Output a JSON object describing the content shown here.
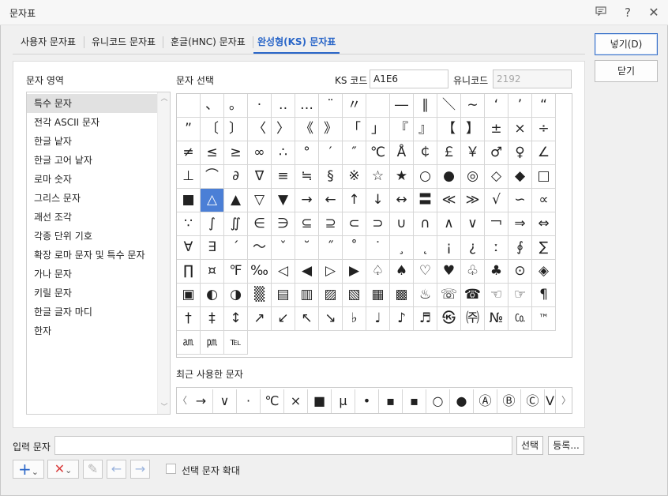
{
  "window": {
    "title": "문자표"
  },
  "tabs": [
    {
      "label": "사용자 문자표"
    },
    {
      "label": "유니코드 문자표"
    },
    {
      "label": "훈글(HNC) 문자표"
    },
    {
      "label": "완성형(KS) 문자표"
    }
  ],
  "labels": {
    "area": "문자 영역",
    "select": "문자 선택",
    "ks_code": "KS 코드",
    "unicode": "유니코드",
    "recent": "최근 사용한 문자",
    "input": "입력 문자",
    "enlarge": "선택 문자 확대"
  },
  "fields": {
    "ks_code_value": "A1E6",
    "unicode_value": "2192",
    "input_value": ""
  },
  "buttons": {
    "insert": "넣기(D)",
    "close": "닫기",
    "select": "선택",
    "register": "등록..."
  },
  "areas": [
    "특수 문자",
    "전각 ASCII 문자",
    "한글 낱자",
    "한글 고어 낱자",
    "로마 숫자",
    "그리스 문자",
    "괘선 조각",
    "각종 단위 기호",
    "확장 로마 문자 및 특수 문자",
    "가나 문자",
    "키릴 문자",
    "한글 글자 마디",
    "한자"
  ],
  "selected_area_index": 0,
  "selected_char_index": 65,
  "chars": [
    "",
    "、",
    "。",
    "·",
    "‥",
    "…",
    "¨",
    "〃",
    "­",
    "―",
    "∥",
    "＼",
    "∼",
    "‘",
    "’",
    "“",
    "”",
    "〔",
    "〕",
    "〈",
    "〉",
    "《",
    "》",
    "「",
    "」",
    "『",
    "』",
    "【",
    "】",
    "±",
    "×",
    "÷",
    "≠",
    "≤",
    "≥",
    "∞",
    "∴",
    "°",
    "′",
    "″",
    "℃",
    "Å",
    "￠",
    "￡",
    "￥",
    "♂",
    "♀",
    "∠",
    "⊥",
    "⌒",
    "∂",
    "∇",
    "≡",
    "≒",
    "§",
    "※",
    "☆",
    "★",
    "○",
    "●",
    "◎",
    "◇",
    "◆",
    "□",
    "■",
    "△",
    "▲",
    "▽",
    "▼",
    "→",
    "←",
    "↑",
    "↓",
    "↔",
    "〓",
    "≪",
    "≫",
    "√",
    "∽",
    "∝",
    "∵",
    "∫",
    "∬",
    "∈",
    "∋",
    "⊆",
    "⊇",
    "⊂",
    "⊃",
    "∪",
    "∩",
    "∧",
    "∨",
    "￢",
    "⇒",
    "⇔",
    "∀",
    "∃",
    "´",
    "～",
    "ˇ",
    "˘",
    "˝",
    "˚",
    "˙",
    "¸",
    "˛",
    "¡",
    "¿",
    "ː",
    "∮",
    "∑",
    "∏",
    "¤",
    "℉",
    "‰",
    "◁",
    "◀",
    "▷",
    "▶",
    "♤",
    "♠",
    "♡",
    "♥",
    "♧",
    "♣",
    "⊙",
    "◈",
    "▣",
    "◐",
    "◑",
    "▒",
    "▤",
    "▥",
    "▨",
    "▧",
    "▦",
    "▩",
    "♨",
    "☏",
    "☎",
    "☜",
    "☞",
    "¶",
    "†",
    "‡",
    "↕",
    "↗",
    "↙",
    "↖",
    "↘",
    "♭",
    "♩",
    "♪",
    "♬",
    "㉿",
    "㈜",
    "№",
    "㏇",
    "™",
    "㏂",
    "㏘",
    "℡"
  ],
  "recent_chars": [
    "→",
    "∨",
    "·",
    "℃",
    "×",
    "■",
    "μ",
    "•",
    "▪",
    "▪",
    "○",
    "●",
    "Ⓐ",
    "Ⓑ",
    "Ⓒ",
    "V"
  ],
  "icons": {
    "help": "?",
    "close": "✕",
    "msg": "▭",
    "add": "+",
    "delete": "✕",
    "edit": "✎",
    "left": "←",
    "right": "→",
    "chevron": "⌄"
  },
  "colors": {
    "accent": "#2a66c8",
    "selected_cell": "#4b7fd6",
    "delete_red": "#d93c3c",
    "add_blue": "#2a66c8"
  }
}
